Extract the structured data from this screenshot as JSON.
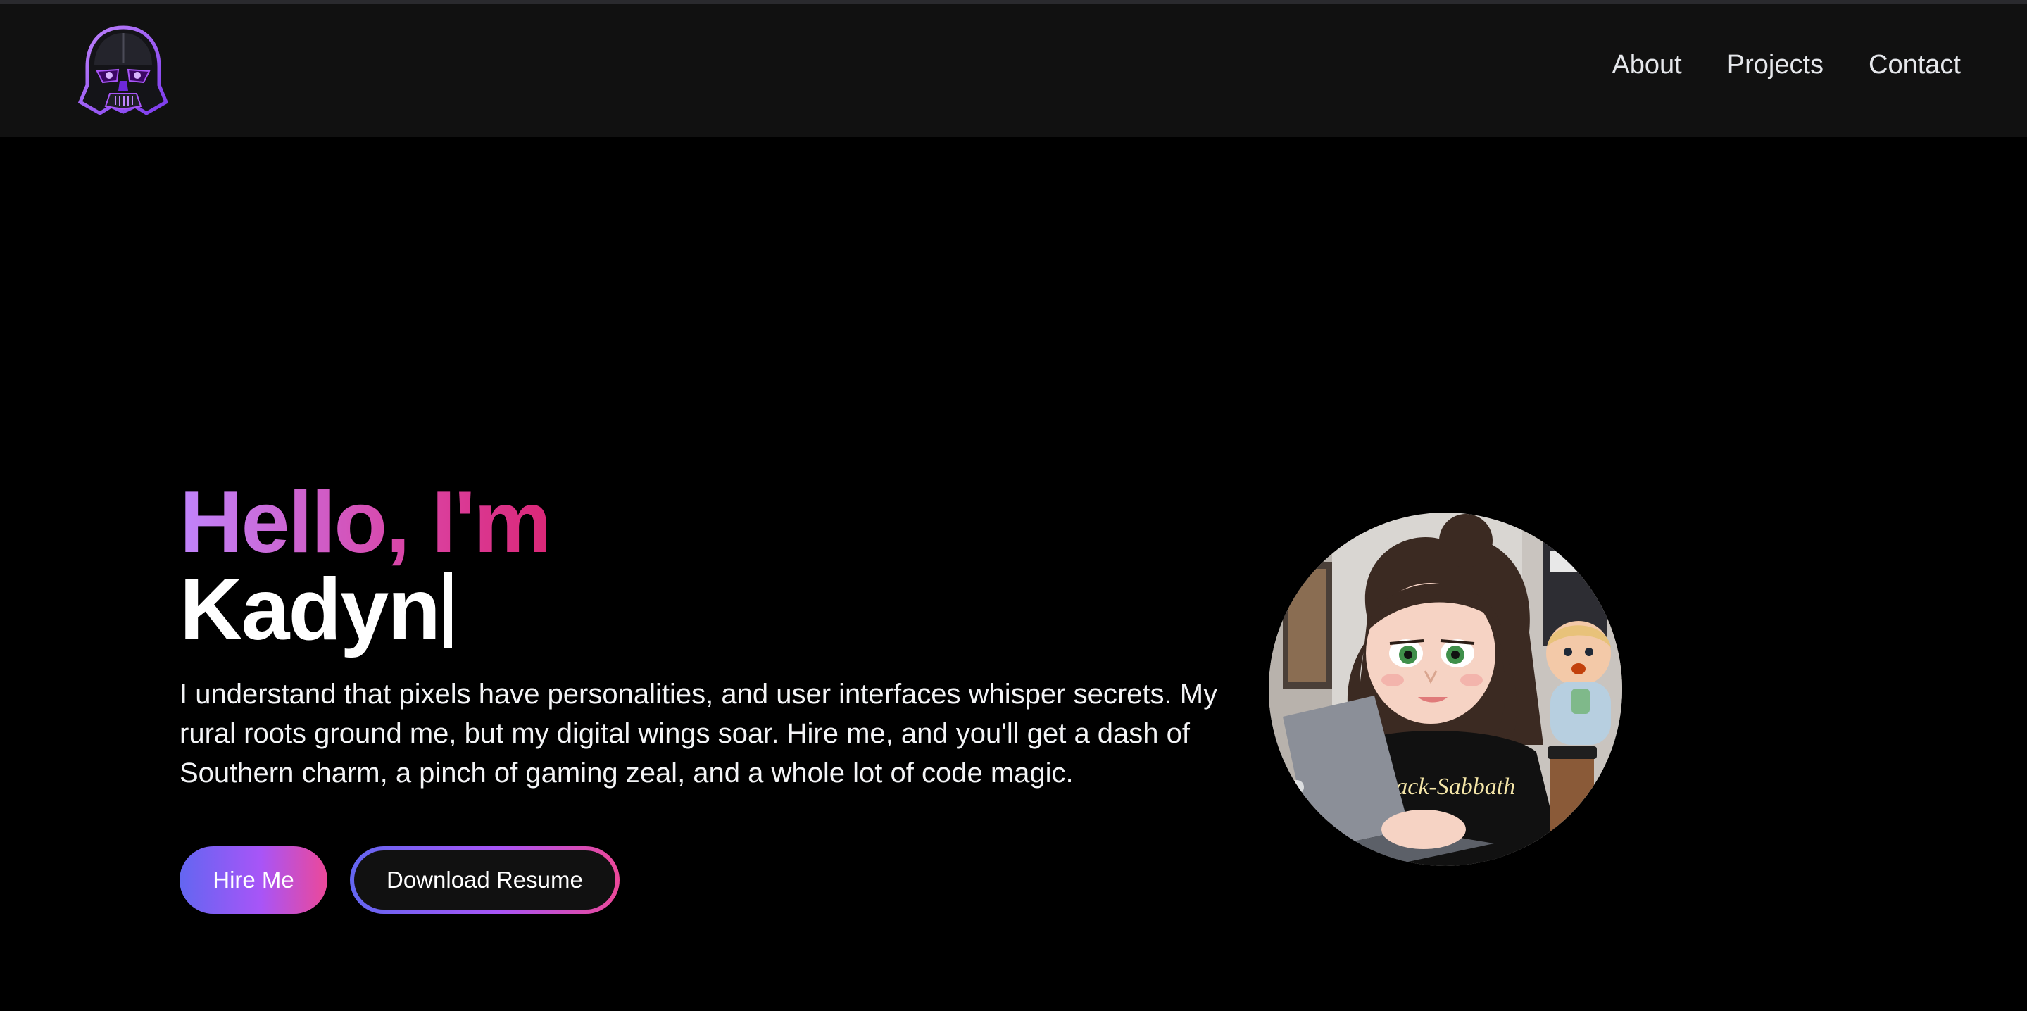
{
  "header": {
    "logo_icon": "darth-vader-helmet-icon",
    "nav": [
      {
        "label": "About"
      },
      {
        "label": "Projects"
      },
      {
        "label": "Contact"
      }
    ]
  },
  "hero": {
    "greeting": "Hello, I'm",
    "name": "Kadyn",
    "tagline": "I understand that pixels have personalities, and user interfaces whisper secrets. My rural roots ground me, but my digital wings soar. Hire me, and you'll get a dash of Southern charm, a pinch of gaming zeal, and a whole lot of code magic.",
    "primary_button": "Hire Me",
    "secondary_button": "Download Resume",
    "avatar_shirt_text": "Black-Sabbath"
  },
  "colors": {
    "background": "#000000",
    "header": "#111111",
    "gradient_start": "#6366f1",
    "gradient_mid": "#a855f7",
    "gradient_end": "#ec4899",
    "greeting_start": "#c084fc",
    "greeting_end": "#db2777"
  }
}
